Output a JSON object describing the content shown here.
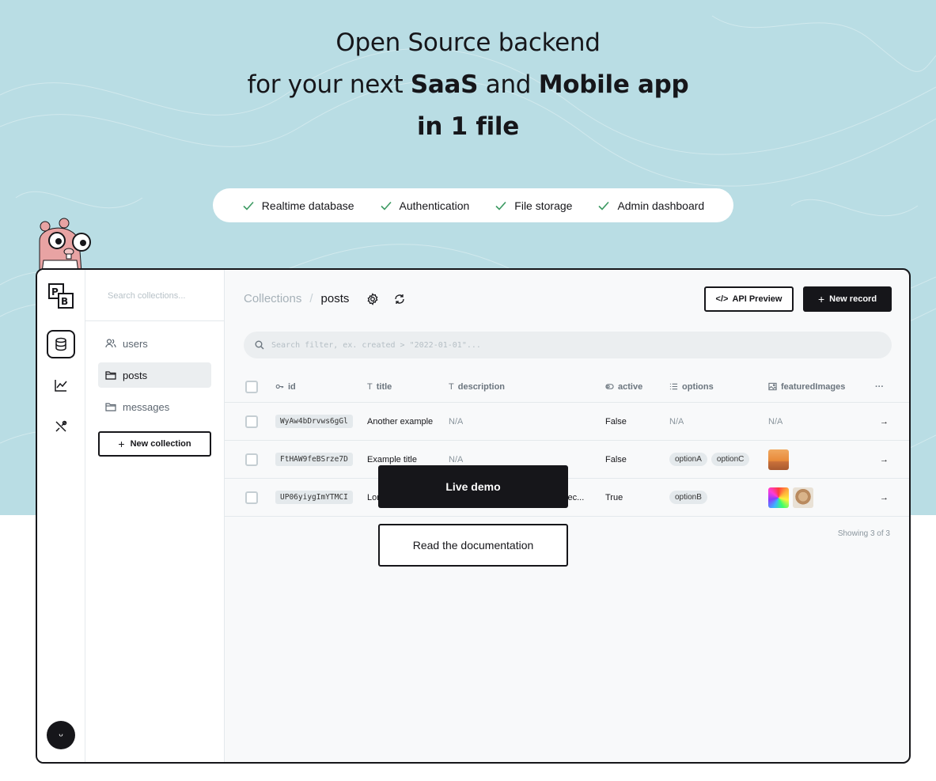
{
  "hero": {
    "line1": "Open Source backend",
    "line2_pre": "for your next ",
    "line2_b1": "SaaS",
    "line2_mid": " and ",
    "line2_b2": "Mobile app",
    "line3": "in 1 file"
  },
  "features": [
    "Realtime database",
    "Authentication",
    "File storage",
    "Admin dashboard"
  ],
  "sidebar": {
    "search_placeholder": "Search collections...",
    "collections": [
      {
        "label": "users",
        "icon": "users-icon"
      },
      {
        "label": "posts",
        "icon": "folder-icon",
        "active": true
      },
      {
        "label": "messages",
        "icon": "folder-icon"
      }
    ],
    "new_collection": "New collection"
  },
  "header": {
    "crumb_root": "Collections",
    "crumb_sep": "/",
    "crumb_current": "posts",
    "api_preview": "API Preview",
    "new_record": "New record"
  },
  "filter": {
    "placeholder": "Search filter, ex. created > \"2022-01-01\"..."
  },
  "table": {
    "columns": [
      "id",
      "title",
      "description",
      "active",
      "options",
      "featuredImages",
      "···"
    ],
    "rows": [
      {
        "id": "WyAw4bDrvws6gGl",
        "title": "Another example",
        "description": "N/A",
        "active": "False",
        "options": [
          "N/A"
        ],
        "images": "N/A"
      },
      {
        "id": "FtHAW9feBSrze7D",
        "title": "Example title",
        "description": "N/A",
        "active": "False",
        "options": [
          "optionA",
          "optionC"
        ],
        "images": [
          "sunset"
        ]
      },
      {
        "id": "UP06yiygImYTMCI",
        "title": "Lor",
        "description": "sec...",
        "active": "True",
        "options": [
          "optionB"
        ],
        "images": [
          "rainbow",
          "cat"
        ]
      }
    ],
    "showing": "Showing 3 of 3"
  },
  "cta": {
    "live_demo": "Live demo",
    "read_docs": "Read the documentation"
  },
  "colors": {
    "hero_bg": "#b9dde4",
    "accent_dark": "#16161a",
    "check_green": "#3c9a62"
  }
}
